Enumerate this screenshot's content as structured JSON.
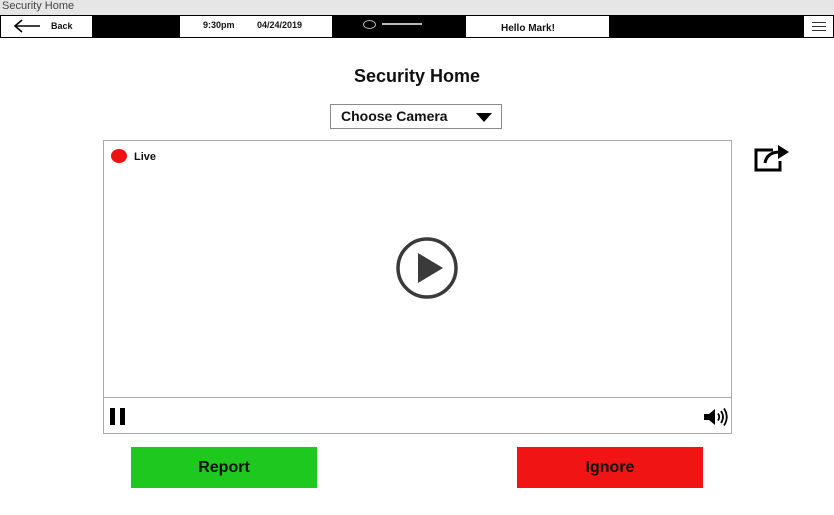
{
  "window": {
    "title": "Security Home"
  },
  "topbar": {
    "back_label": "Back",
    "time": "9:30pm",
    "date": "04/24/2019",
    "greeting": "Hello Mark!"
  },
  "main": {
    "title": "Security Home",
    "camera_select": {
      "selected": "Choose Camera"
    },
    "video": {
      "status_label": "Live"
    }
  },
  "actions": {
    "report_label": "Report",
    "ignore_label": "Ignore"
  },
  "colors": {
    "live": "#f01010",
    "report": "#1ec81e",
    "ignore": "#f01414"
  },
  "icons": [
    "back-arrow-icon",
    "camera-notch-icon",
    "menu-icon",
    "dropdown-caret-icon",
    "live-dot-icon",
    "play-icon",
    "pause-icon",
    "volume-icon",
    "share-icon"
  ]
}
